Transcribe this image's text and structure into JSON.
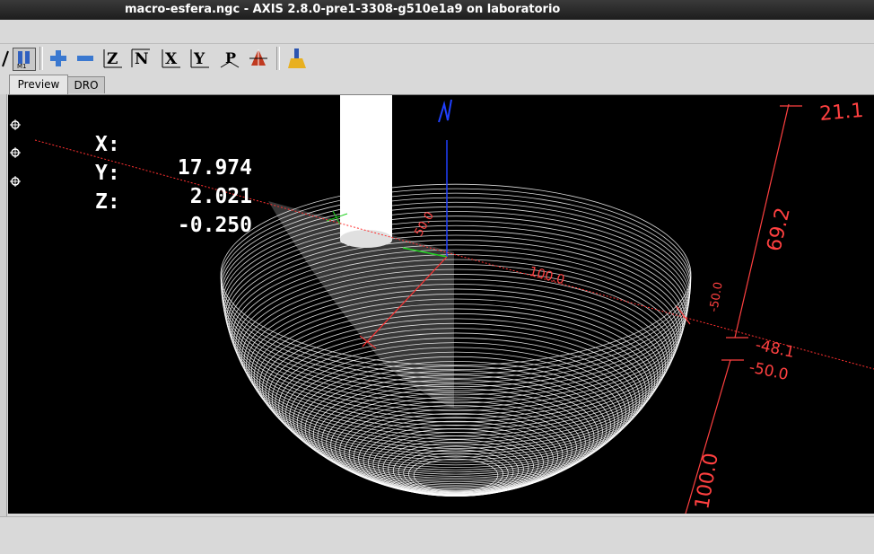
{
  "window": {
    "title": "macro-esfera.ngc - AXIS 2.8.0-pre1-3308-g510e1a9 on laboratorio"
  },
  "toolbar": {
    "buttons": [
      {
        "name": "toggle-view-icon",
        "label": "/"
      },
      {
        "name": "machine-coords-icon",
        "label": "M1"
      },
      {
        "name": "zoom-in-icon",
        "label": "+"
      },
      {
        "name": "zoom-out-icon",
        "label": "−"
      },
      {
        "name": "view-z-icon",
        "label": "Z"
      },
      {
        "name": "view-z2-icon",
        "label": "N"
      },
      {
        "name": "view-x-icon",
        "label": "X"
      },
      {
        "name": "view-y-icon",
        "label": "Y"
      },
      {
        "name": "view-p-icon",
        "label": "P"
      },
      {
        "name": "view-3d-icon",
        "label": ""
      },
      {
        "name": "clear-backplot-icon",
        "label": ""
      }
    ]
  },
  "tabs": [
    {
      "label": "Preview",
      "active": true
    },
    {
      "label": "DRO",
      "active": false
    }
  ],
  "dro": [
    {
      "axis": "X:",
      "value": "17.974"
    },
    {
      "axis": "Y:",
      "value": "2.021"
    },
    {
      "axis": "Z:",
      "value": "-0.250"
    }
  ],
  "dimensions": {
    "x_len": "100.0",
    "y_len": "69.2",
    "z_top": "21.1",
    "z_left": "-50.0",
    "y_mid": "-48.1",
    "y_low": "-50.0",
    "z_len": "100.0",
    "axis_x": "50.0"
  },
  "colors": {
    "preview_bg": "#000000",
    "toolpath": "#ffffff",
    "dimension": "#ff4040",
    "axis_x": "#ff3030",
    "axis_y": "#20d020",
    "axis_z": "#2040ff"
  }
}
